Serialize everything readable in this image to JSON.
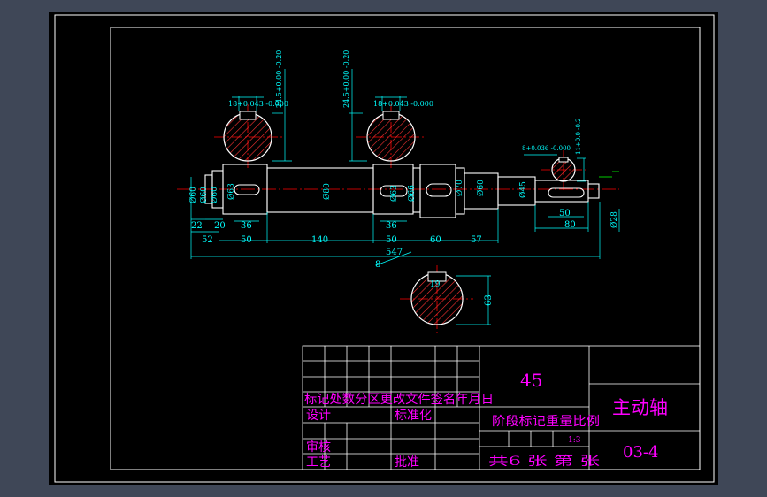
{
  "colors": {
    "background": "#3f4757",
    "paper": "#000000",
    "frame": "#ffffff",
    "dimension": "#00ffff",
    "centerline": "#ff0000",
    "hatch": "#ff0000",
    "title_text": "#ff00ff",
    "leader": "#00ff00"
  },
  "views": {
    "section_left": {
      "tol": "18+0.043 -0.000",
      "dim": "24.5+0.00 -0.20"
    },
    "section_mid": {
      "tol": "18+0.043 -0.000",
      "dim": "24.5+0.00 -0.20"
    },
    "section_right": {
      "tol": "8+0.036 -0.000",
      "dim": "11+0.0 -0.2"
    },
    "section_bottom": {
      "key": "19",
      "dim": "63"
    }
  },
  "dimensions": {
    "diameters": [
      "Ø60",
      "Ø60",
      "Ø60",
      "Ø63",
      "Ø80",
      "Ø63",
      "Ø66",
      "Ø70",
      "Ø60",
      "Ø45",
      "Ø28"
    ],
    "lengths": [
      "22",
      "20",
      "52",
      "36",
      "50",
      "140",
      "36",
      "50",
      "60",
      "57",
      "50",
      "80",
      "547"
    ],
    "note": "8"
  },
  "title_block": {
    "material": "45",
    "part_name": "主动轴",
    "drawing_no": "03-4",
    "revision_header": "标记处数分区更改文件签名年月日",
    "design": "设计",
    "standardize": "标准化",
    "stage_mark": "阶段标记重量比例",
    "scale": "1:3",
    "review": "审核",
    "process": "工艺",
    "approve": "批准",
    "sheets": "共6 张 第 张"
  }
}
